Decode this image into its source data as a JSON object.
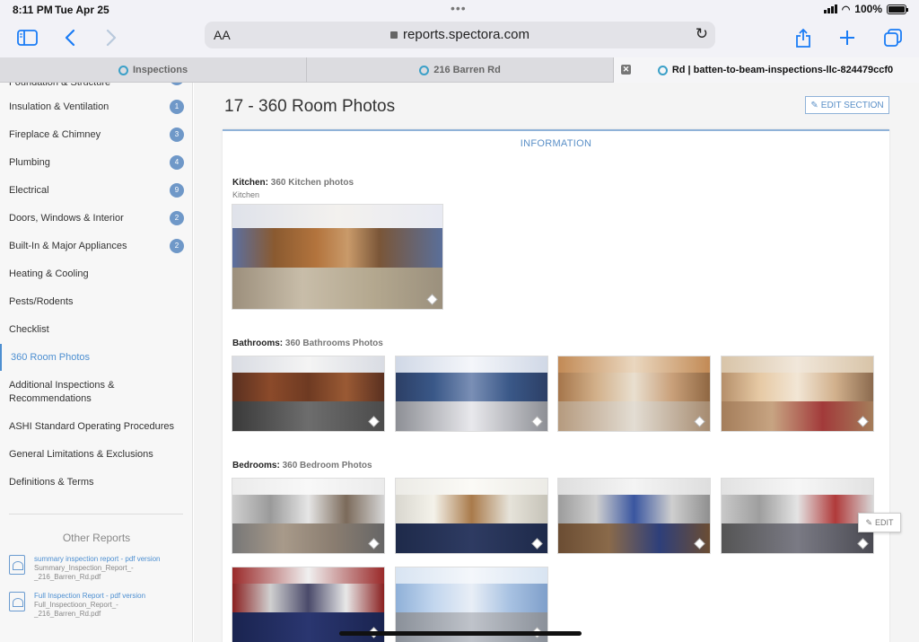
{
  "status": {
    "time": "8:11 PM",
    "date": "Tue Apr 25",
    "battery": "100%"
  },
  "toolbar": {
    "text_size": "AA",
    "url": "reports.spectora.com"
  },
  "tabs": [
    {
      "label": "Inspections"
    },
    {
      "label": "216 Barren Rd"
    },
    {
      "label": "Rd | batten-to-beam-inspections-llc-824479ccf0"
    }
  ],
  "sidebar": {
    "items": [
      {
        "label": "Foundation & Structure",
        "badge": ""
      },
      {
        "label": "Insulation & Ventilation",
        "badge": "1"
      },
      {
        "label": "Fireplace & Chimney",
        "badge": "3"
      },
      {
        "label": "Plumbing",
        "badge": "4"
      },
      {
        "label": "Electrical",
        "badge": "9"
      },
      {
        "label": "Doors, Windows & Interior",
        "badge": "2"
      },
      {
        "label": "Built-In & Major Appliances",
        "badge": "2"
      },
      {
        "label": "Heating & Cooling",
        "badge": ""
      },
      {
        "label": "Pests/Rodents",
        "badge": ""
      },
      {
        "label": "Checklist",
        "badge": ""
      },
      {
        "label": "360 Room Photos",
        "badge": ""
      },
      {
        "label": "Additional Inspections &",
        "label2": "Recommendations",
        "badge": ""
      },
      {
        "label": "ASHI Standard Operating Procedures",
        "badge": ""
      },
      {
        "label": "General Limitations & Exclusions",
        "badge": ""
      },
      {
        "label": "Definitions & Terms",
        "badge": ""
      }
    ],
    "other_reports_title": "Other Reports",
    "reports": [
      {
        "title": "summary inspection report - pdf version",
        "file": "Summary_Inspection_Report_-_216_Barren_Rd.pdf"
      },
      {
        "title": "Full Inspection Report - pdf version",
        "file": "Full_Inspectioon_Report_-_216_Barren_Rd.pdf"
      }
    ]
  },
  "main": {
    "title": "17 - 360 Room Photos",
    "edit_section": "EDIT SECTION",
    "information": "INFORMATION",
    "edit": "EDIT",
    "sections": [
      {
        "label": "Kitchen:",
        "value": "360 Kitchen photos",
        "sub": "Kitchen"
      },
      {
        "label": "Bathrooms:",
        "value": "360 Bathrooms Photos"
      },
      {
        "label": "Bedrooms:",
        "value": "360 Bedroom Photos"
      }
    ]
  }
}
